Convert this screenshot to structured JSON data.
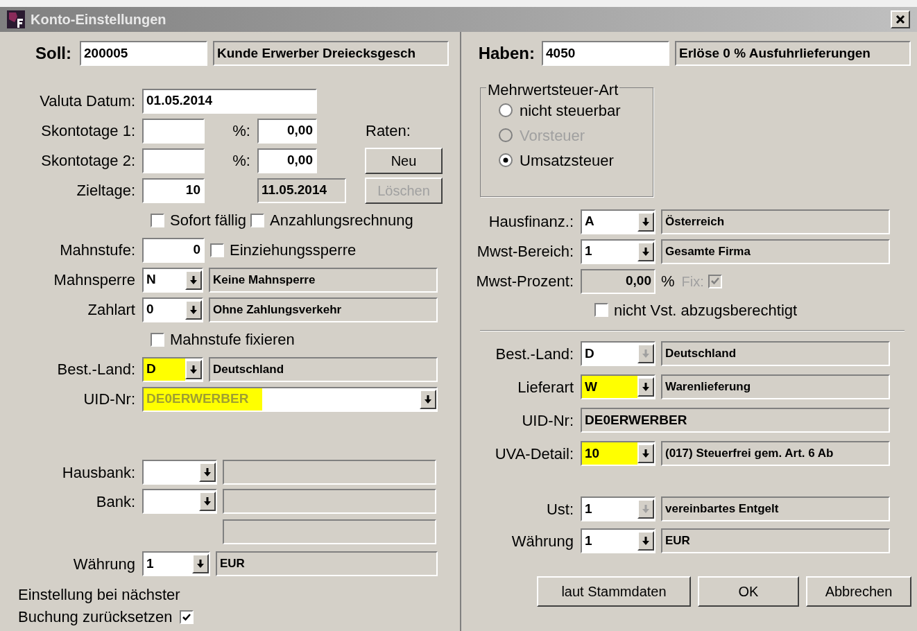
{
  "window": {
    "title": "Konto-Einstellungen"
  },
  "soll": {
    "label": "Soll:",
    "account": "200005",
    "name": "Kunde Erwerber Dreiecksgesch"
  },
  "haben": {
    "label": "Haben:",
    "account": "4050",
    "name": "Erlöse 0 % Ausfuhrlieferungen"
  },
  "left": {
    "valuta": {
      "label": "Valuta Datum:",
      "value": "01.05.2014"
    },
    "skonto": [
      {
        "label": "Skontotage 1:",
        "percent_label": "%:",
        "percent": "0,00"
      },
      {
        "label": "Skontotage 2:",
        "percent_label": "%:",
        "percent": "0,00"
      }
    ],
    "raten": {
      "label": "Raten:",
      "buttons": [
        {
          "label": "Neu",
          "disabled": false
        },
        {
          "label": "Löschen",
          "disabled": true
        }
      ]
    },
    "zieltage": {
      "label": "Zieltage:",
      "value": "10",
      "due_date": "11.05.2014"
    },
    "flags": [
      {
        "label": "Sofort fällig",
        "checked": false
      },
      {
        "label": "Anzahlungsrechnung",
        "checked": false
      }
    ],
    "mahnstufe": {
      "label": "Mahnstufe:",
      "value": "0",
      "checkbox": {
        "label": "Einziehungssperre",
        "checked": false
      }
    },
    "mahnsperre": {
      "label": "Mahnsperre",
      "code": "N",
      "description": "Keine Mahnsperre",
      "highlighted": false
    },
    "zahlart": {
      "label": "Zahlart",
      "code": "0",
      "description": "Ohne Zahlungsverkehr",
      "highlighted": false
    },
    "mahnstufe_fixieren": {
      "label": "Mahnstufe fixieren",
      "checked": false
    },
    "best_land": {
      "label": "Best.-Land:",
      "code": "D",
      "description": "Deutschland",
      "highlighted": true
    },
    "uid": {
      "label": "UID-Nr:",
      "value": "DE0ERWERBER",
      "highlighted": true
    },
    "hausbank": {
      "label": "Hausbank:"
    },
    "bank": {
      "label": "Bank:"
    },
    "waehrung": {
      "label": "Währung",
      "code": "1",
      "description": "EUR",
      "highlighted": false
    },
    "reset": {
      "line1": "Einstellung bei nächster",
      "line2": "Buchung zurücksetzen",
      "checked": true
    }
  },
  "right": {
    "mwst_art": {
      "title": "Mehrwertsteuer-Art",
      "options": [
        {
          "label": "nicht steuerbar",
          "selected": false,
          "disabled": false
        },
        {
          "label": "Vorsteuer",
          "selected": false,
          "disabled": true
        },
        {
          "label": "Umsatzsteuer",
          "selected": true,
          "disabled": false
        }
      ]
    },
    "hausfinanz": {
      "label": "Hausfinanz.:",
      "code": "A",
      "description": "Österreich",
      "highlighted": false,
      "disabled": false
    },
    "mwst_bereich": {
      "label": "Mwst-Bereich:",
      "code": "1",
      "description": "Gesamte Firma",
      "highlighted": false,
      "disabled": false
    },
    "mwst_prozent": {
      "label": "Mwst-Prozent:",
      "value": "0,00",
      "unit": "%",
      "fix": {
        "label": "Fix:",
        "checked": true,
        "disabled": true
      }
    },
    "nicht_vst": {
      "label": "nicht Vst. abzugsberechtigt",
      "checked": false
    },
    "best_land": {
      "label": "Best.-Land:",
      "code": "D",
      "description": "Deutschland",
      "highlighted": false,
      "disabled": true
    },
    "lieferart": {
      "label": "Lieferart",
      "code": "W",
      "description": "Warenlieferung",
      "highlighted": true,
      "disabled": false
    },
    "uid": {
      "label": "UID-Nr:",
      "value": "DE0ERWERBER"
    },
    "uva_detail": {
      "label": "UVA-Detail:",
      "code": "10",
      "description": "(017) Steuerfrei gem. Art. 6 Ab",
      "highlighted": true,
      "disabled": false
    },
    "ust": {
      "label": "Ust:",
      "code": "1",
      "description": "vereinbartes Entgelt",
      "highlighted": false,
      "disabled": true
    },
    "waehrung": {
      "label": "Währung",
      "code": "1",
      "description": "EUR",
      "highlighted": false,
      "disabled": false
    }
  },
  "buttons": [
    {
      "label": "laut Stammdaten"
    },
    {
      "label": "OK"
    },
    {
      "label": "Abbrechen"
    }
  ]
}
